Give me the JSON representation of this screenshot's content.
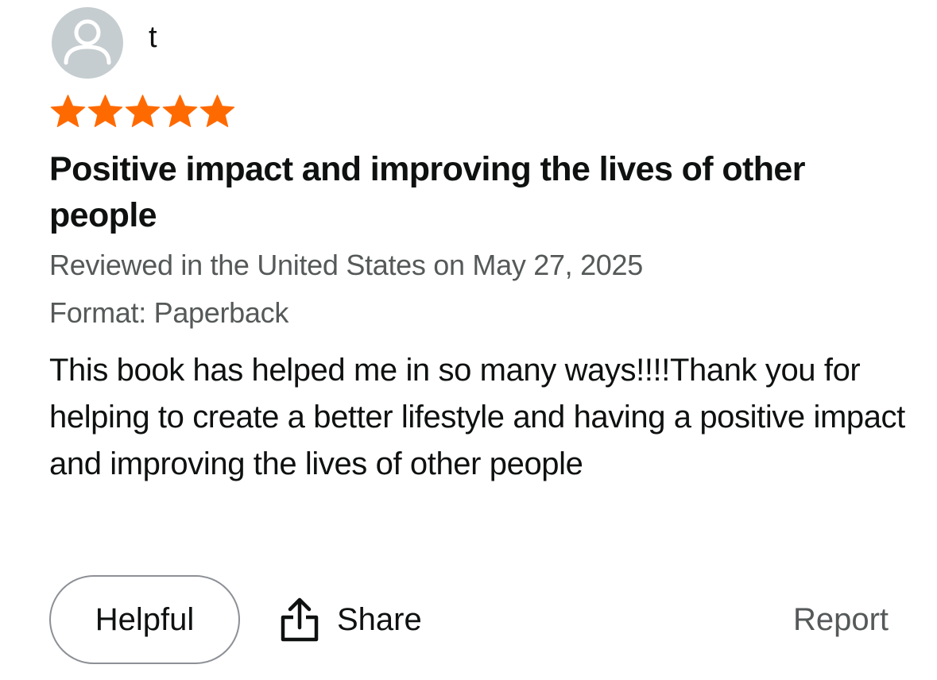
{
  "review": {
    "author": "t",
    "avatar_icon": "user-silhouette-icon",
    "rating": 5,
    "rating_max": 5,
    "star_color": "#ff6a00",
    "title": "Positive impact and improving the lives of other people",
    "reviewed_line": "Reviewed in the United States on May 27, 2025",
    "format_line": "Format: Paperback",
    "body": "This book has helped me in so many ways!!!!Thank you for helping to create a better lifestyle and having a positive impact and improving the lives of other people"
  },
  "actions": {
    "helpful_label": "Helpful",
    "share_label": "Share",
    "share_icon": "share-icon",
    "report_label": "Report"
  },
  "colors": {
    "text": "#0f1111",
    "secondary_text": "#565959",
    "avatar_bg": "#c6cdd0",
    "button_border": "#8d9096"
  }
}
